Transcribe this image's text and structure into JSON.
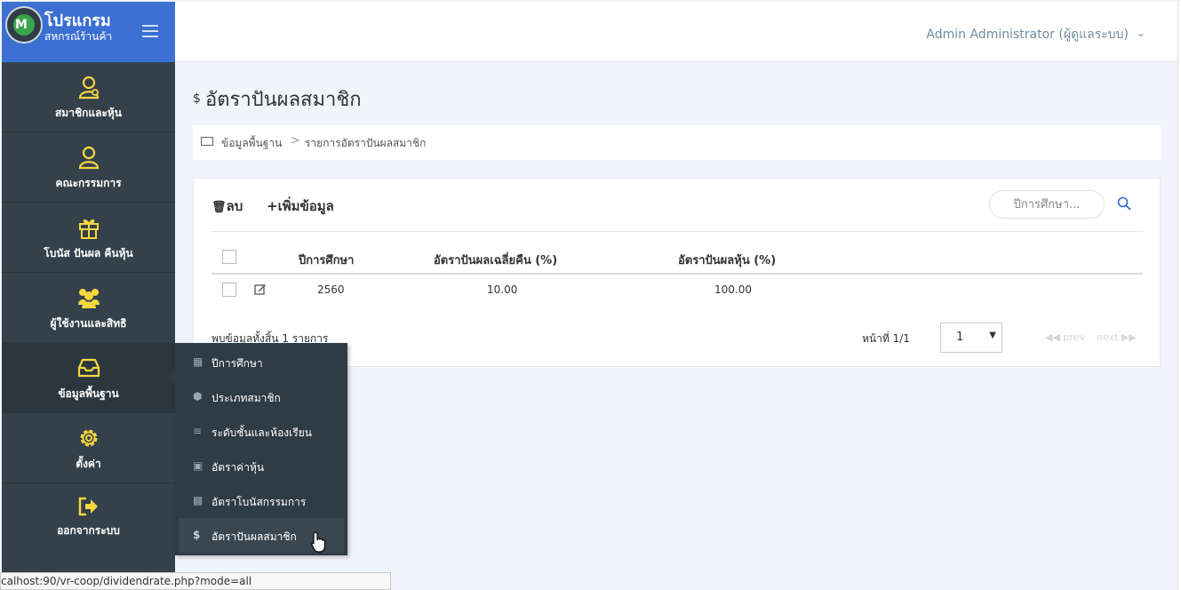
{
  "brand": {
    "title": "โปรแกรม",
    "subtitle": "สหกรณ์ร้านค้า"
  },
  "sidebar": {
    "items": [
      {
        "label": "สมาชิกและหุ้น",
        "icon": "member-icon"
      },
      {
        "label": "คณะกรรมการ",
        "icon": "user-icon"
      },
      {
        "label": "โบนัส ปันผล คืนหุ้น",
        "icon": "gift-icon"
      },
      {
        "label": "ผู้ใช้งานและสิทธิ",
        "icon": "users-icon"
      },
      {
        "label": "ข้อมูลพื้นฐาน",
        "icon": "inbox-icon"
      },
      {
        "label": "ตั้งค่า",
        "icon": "gear-icon"
      },
      {
        "label": "ออกจากระบบ",
        "icon": "logout-icon"
      }
    ]
  },
  "header": {
    "user": "Admin Administrator (ผู้ดูแลระบบ)"
  },
  "page": {
    "dollar": "$",
    "title": "อัตราปันผลสมาชิก"
  },
  "breadcrumb": {
    "home": "ข้อมูลพื้นฐาน",
    "sep": ">",
    "current": "รายการอัตราปันผลสมาชิก"
  },
  "toolbar": {
    "delete": "ลบ",
    "add": "เพิ่มข้อมูล",
    "search_placeholder": "ปีการศึกษา..."
  },
  "table": {
    "headers": [
      "ปีการศึกษา",
      "อัตราปันผลเฉลี่ยคืน (%)",
      "อัตราปันผลหุ้น (%)"
    ],
    "rows": [
      {
        "year": "2560",
        "avg_return": "10.00",
        "share": "100.00"
      }
    ]
  },
  "footer": {
    "found": "พบข้อมูลทั้งสิ้น 1 รายการ",
    "pageinfo": "หน้าที่ 1/1",
    "page_value": "1",
    "prev": "◀◀ prev",
    "next": "next ▶▶"
  },
  "flyout": {
    "items": [
      {
        "label": "ปีการศึกษา",
        "icon": "calendar-icon"
      },
      {
        "label": "ประเภทสมาชิก",
        "icon": "cube-icon"
      },
      {
        "label": "ระดับชั้นและห้องเรียน",
        "icon": "layers-icon"
      },
      {
        "label": "อัตราค่าหุ้น",
        "icon": "money-icon"
      },
      {
        "label": "อัตราโบนัสกรรมการ",
        "icon": "gift-icon"
      },
      {
        "label": "อัตราปันผลสมาชิก",
        "icon": "dollar-icon"
      }
    ]
  },
  "statusbar": {
    "url": "calhost:90/vr-coop/dividendrate.php?mode=all"
  },
  "colors": {
    "brand": "#3b6fd1",
    "sidebar": "#34414a",
    "icon_yellow": "#f5d63d",
    "accent": "#2f6bd1"
  }
}
